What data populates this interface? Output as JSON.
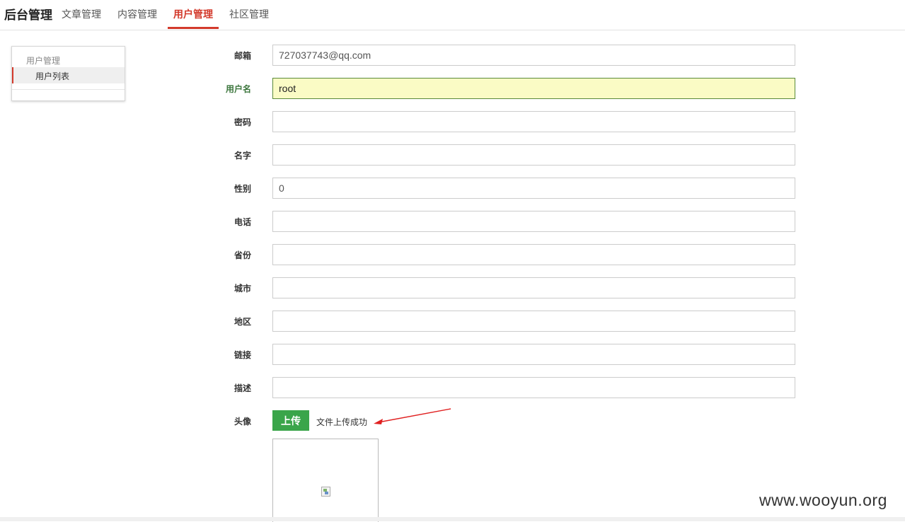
{
  "nav": {
    "brand": "后台管理",
    "items": [
      {
        "label": "文章管理"
      },
      {
        "label": "内容管理"
      },
      {
        "label": "用户管理"
      },
      {
        "label": "社区管理"
      }
    ],
    "accent_color": "#d33a2c"
  },
  "sidebar": {
    "group_label": "用户管理",
    "items": [
      {
        "label": "用户列表",
        "active": true
      }
    ]
  },
  "form": {
    "email": {
      "label": "邮箱",
      "value": "727037743@qq.com"
    },
    "username": {
      "label": "用户名",
      "value": "root"
    },
    "password": {
      "label": "密码",
      "value": ""
    },
    "name": {
      "label": "名字",
      "value": ""
    },
    "gender": {
      "label": "性别",
      "value": "0"
    },
    "phone": {
      "label": "电话",
      "value": ""
    },
    "province": {
      "label": "省份",
      "value": ""
    },
    "city": {
      "label": "城市",
      "value": ""
    },
    "district": {
      "label": "地区",
      "value": ""
    },
    "link": {
      "label": "链接",
      "value": ""
    },
    "description": {
      "label": "描述",
      "value": ""
    },
    "avatar": {
      "label": "头像",
      "upload_button": "上传",
      "status": "文件上传成功"
    }
  },
  "annotation": {
    "arrow_color": "#e02020"
  },
  "watermark": "www.wooyun.org"
}
